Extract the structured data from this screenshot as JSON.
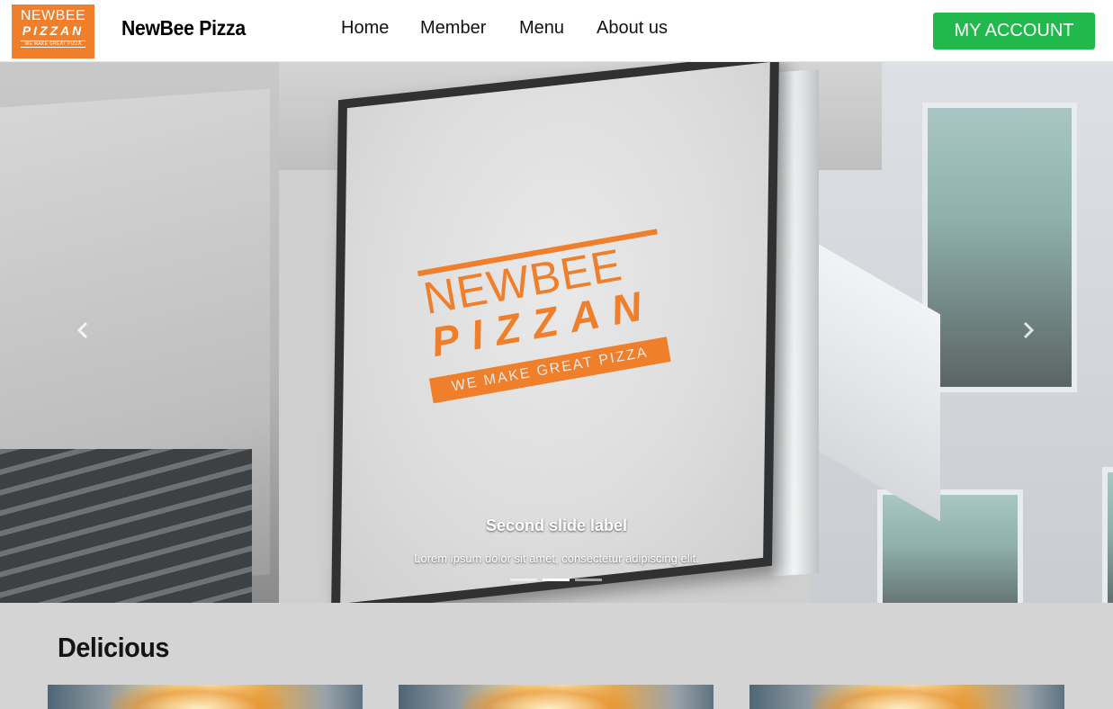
{
  "header": {
    "logo": {
      "line1": "NEWBEE",
      "line2": "PIZZAN",
      "tagline": "WE MAKE GREAT PIZZA"
    },
    "brand_name": "NewBee Pizza",
    "nav": [
      {
        "label": "Home"
      },
      {
        "label": "Member"
      },
      {
        "label": "Menu"
      },
      {
        "label": "About us"
      }
    ],
    "account_button": "MY ACCOUNT"
  },
  "carousel": {
    "sign_logo": {
      "line1": "NEWBEE",
      "line2": "PIZZAN",
      "tagline": "WE MAKE GREAT PIZZA"
    },
    "prev_icon": "chevron-left-icon",
    "next_icon": "chevron-right-icon",
    "caption_title": "Second slide label",
    "caption_text": "Lorem ipsum dolor sit amet, consectetur adipiscing elit.",
    "slide_count": 3,
    "active_slide": 2
  },
  "section": {
    "title": "Delicious"
  },
  "colors": {
    "brand_orange": "#ef7f2a",
    "account_green": "#21b84c",
    "section_bg": "#d4d4d4"
  }
}
